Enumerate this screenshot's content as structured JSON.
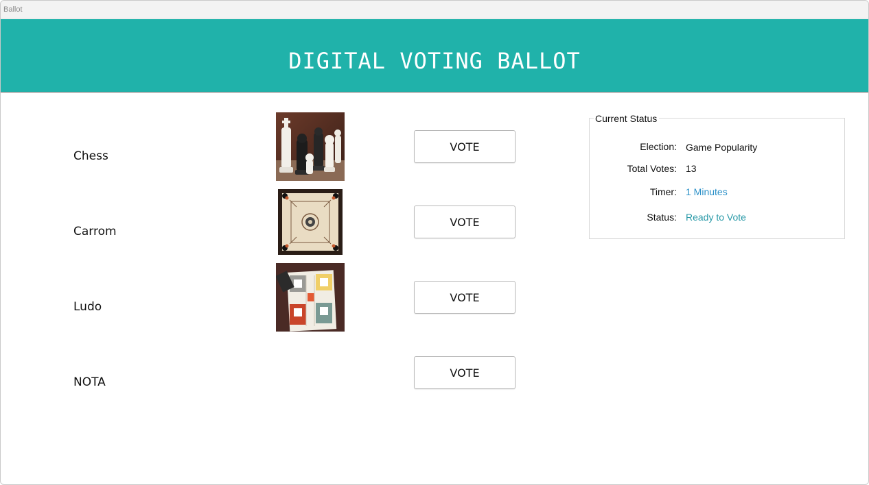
{
  "window": {
    "title": "Ballot"
  },
  "banner": {
    "title": "DIGITAL VOTING BALLOT",
    "color": "#20b2aa"
  },
  "candidates": [
    {
      "name": "Chess",
      "image": "chess-pieces-image",
      "vote_label": "VOTE"
    },
    {
      "name": "Carrom",
      "image": "carrom-board-image",
      "vote_label": "VOTE"
    },
    {
      "name": "Ludo",
      "image": "ludo-board-image",
      "vote_label": "VOTE"
    },
    {
      "name": "NOTA",
      "image": "",
      "vote_label": "VOTE"
    }
  ],
  "status": {
    "legend": "Current Status",
    "election_label": "Election:",
    "election_value": "Game Popularity",
    "total_votes_label": "Total Votes:",
    "total_votes_value": "13",
    "timer_label": "Timer:",
    "timer_value": "1 Minutes",
    "status_label": "Status:",
    "status_value": "Ready to Vote"
  }
}
